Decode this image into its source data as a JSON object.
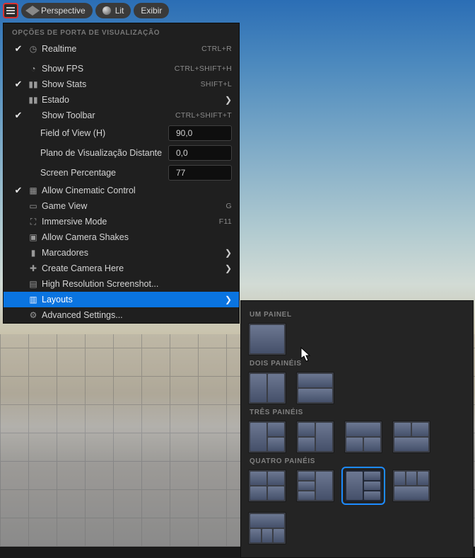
{
  "toolbar": {
    "perspective": "Perspective",
    "lit": "Lit",
    "exibir": "Exibir"
  },
  "menu": {
    "header": "OPÇÕES DE PORTA DE VISUALIZAÇÃO",
    "realtime": {
      "label": "Realtime",
      "shortcut": "CTRL+R",
      "checked": true
    },
    "showfps": {
      "label": "Show FPS",
      "shortcut": "CTRL+SHIFT+H",
      "checked": false
    },
    "showstats": {
      "label": "Show Stats",
      "shortcut": "SHIFT+L",
      "checked": true
    },
    "estado": {
      "label": "Estado"
    },
    "showtoolbar": {
      "label": "Show Toolbar",
      "shortcut": "CTRL+SHIFT+T",
      "checked": true
    },
    "fov": {
      "label": "Field of View (H)",
      "value": "90,0"
    },
    "farplane": {
      "label": "Plano de Visualização Distante",
      "value": "0,0"
    },
    "screenpct": {
      "label": "Screen Percentage",
      "value": "77"
    },
    "cinematic": {
      "label": "Allow Cinematic Control",
      "checked": true
    },
    "gameview": {
      "label": "Game View",
      "shortcut": "G"
    },
    "immersive": {
      "label": "Immersive Mode",
      "shortcut": "F11"
    },
    "camerashakes": {
      "label": "Allow Camera Shakes"
    },
    "marcadores": {
      "label": "Marcadores"
    },
    "createcamera": {
      "label": "Create Camera Here"
    },
    "hires": {
      "label": "High Resolution Screenshot..."
    },
    "layouts": {
      "label": "Layouts"
    },
    "advanced": {
      "label": "Advanced Settings..."
    }
  },
  "submenu": {
    "onepanel": "UM PAINEL",
    "twopanels": "DOIS PAINÉIS",
    "threepanels": "TRÊS PAINÉIS",
    "fourpanels": "QUATRO PAINÉIS"
  }
}
